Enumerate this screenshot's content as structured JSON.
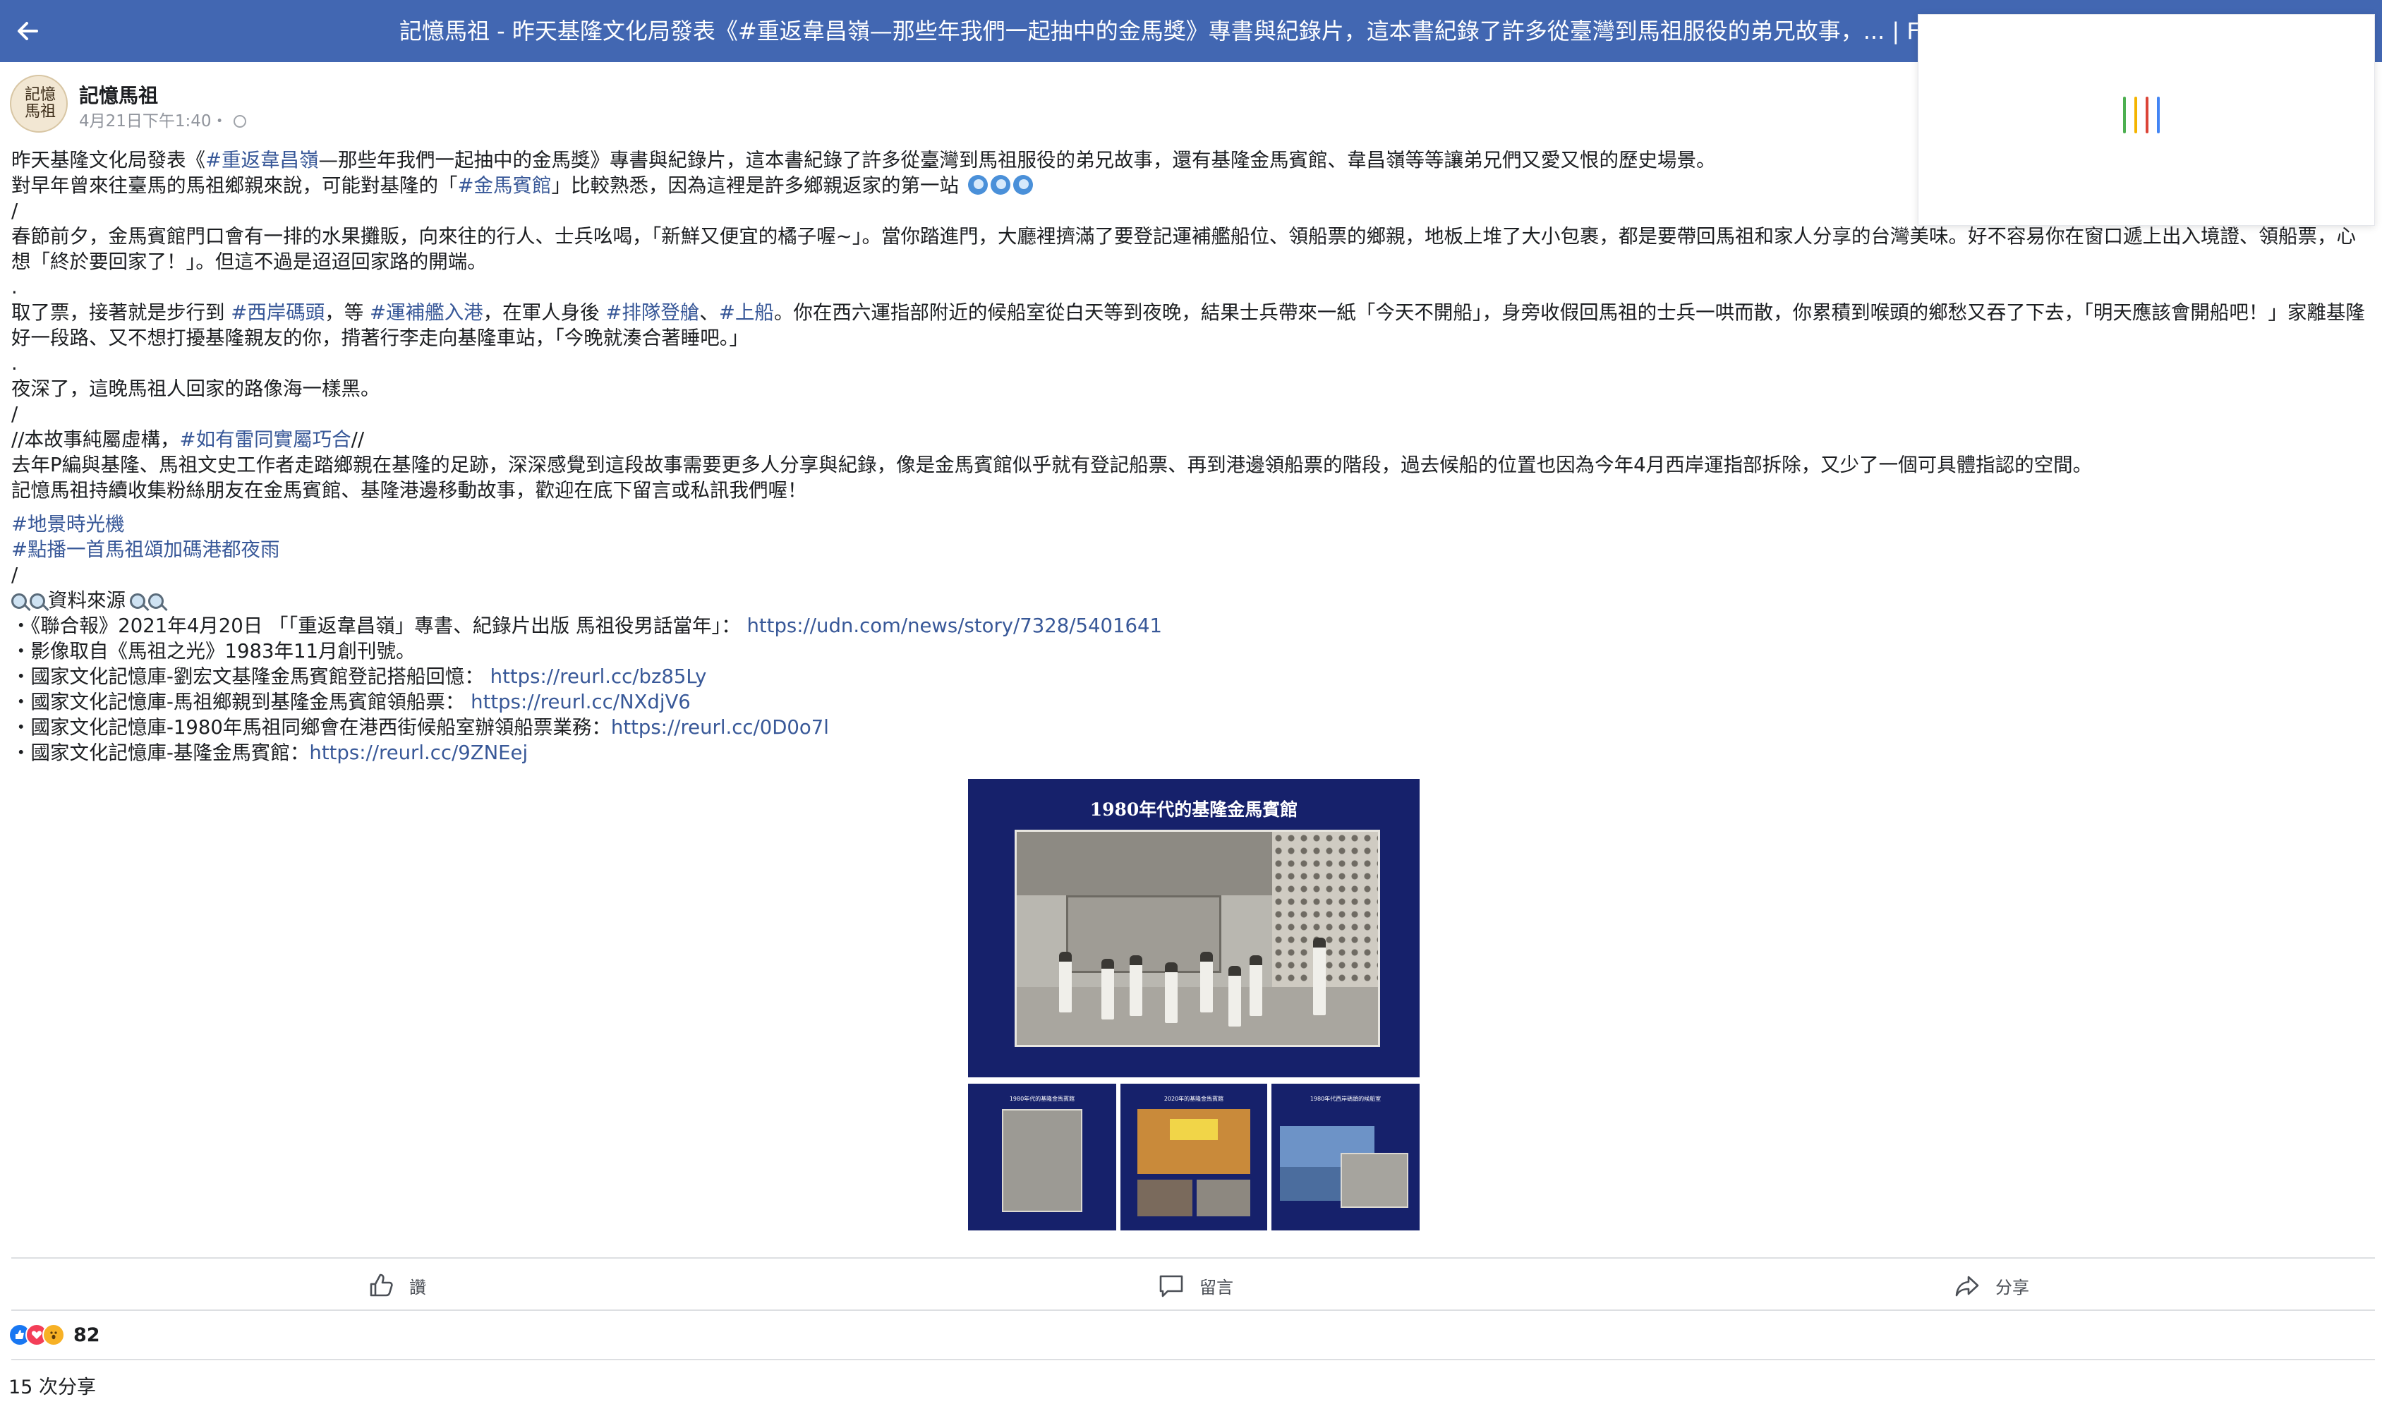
{
  "window": {
    "title": "記憶馬祖 - 昨天基隆文化局發表《#重返韋昌嶺—那些年我們一起抽中的金馬獎》專書與紀錄片，這本書紀錄了許多從臺灣到馬祖服役的弟兄故事，... | Facebook"
  },
  "colors": {
    "topbar": "#4267b2",
    "link": "#385898",
    "text": "#1c1e21",
    "meta": "#90949c",
    "image_bg": "#16216b"
  },
  "post": {
    "page_name": "記憶馬祖",
    "avatar_text": "記憶馬祖",
    "timestamp": "4月21日下午1:40",
    "privacy_icon": "globe-icon",
    "body": {
      "l1": {
        "a": "昨天基隆文化局發表《",
        "b": "#重返韋昌嶺",
        "c": "—那些年我們一起抽中的金馬獎》專書與紀錄片，這本書紀錄了許多從臺灣到馬祖服役的弟兄故事，還有基隆金馬賓館、韋昌嶺等等讓弟兄們又愛又恨的歷史場景。"
      },
      "l2": {
        "a": "對早年曾來往臺馬的馬祖鄉親來說，可能對基隆的「",
        "b": "#金馬賓館",
        "c": "」比較熟悉，因為這裡是許多鄉親返家的第一站"
      },
      "sep1": "/",
      "p2": "春節前夕，金馬賓館門口會有一排的水果攤販，向來往的行人、士兵吆喝，「新鮮又便宜的橘子喔~」。當你踏進門，大廳裡擠滿了要登記運補艦船位、領船票的鄉親，地板上堆了大小包裹，都是要帶回馬祖和家人分享的台灣美味。好不容易你在窗口遞上出入境證、領船票，心想「終於要回家了！」。但這不過是迢迢回家路的開端。",
      "sep2": ".",
      "p3": {
        "a": "取了票，接著就是步行到 ",
        "b": "#西岸碼頭",
        "c": "，等 ",
        "d": "#運補艦入港",
        "e": "，在軍人身後 ",
        "f": "#排隊登艙",
        "g": "、",
        "h": "#上船",
        "i": "。你在西六運指部附近的候船室從白天等到夜晚，結果士兵帶來一紙「今天不開船」，身旁收假回馬祖的士兵一哄而散，你累積到喉頭的鄉愁又吞了下去，「明天應該會開船吧！」家離基隆好一段路、又不想打擾基隆親友的你，揹著行李走向基隆車站，「今晚就湊合著睡吧。」"
      },
      "sep3": ".",
      "p4": "夜深了，這晚馬祖人回家的路像海一樣黑。",
      "sep4": "/",
      "p5": {
        "a": "//本故事純屬虛構，",
        "b": "#如有雷同實屬巧合",
        "c": "//"
      },
      "p6": "去年P編與基隆、馬祖文史工作者走踏鄉親在基隆的足跡，深深感覺到這段故事需要更多人分享與紀錄，像是金馬賓館似乎就有登記船票、再到港邊領船票的階段，過去候船的位置也因為今年4月西岸運指部拆除，又少了一個可具體指認的空間。",
      "p7": "記憶馬祖持續收集粉絲朋友在金馬賓館、基隆港邊移動故事，歡迎在底下留言或私訊我們喔！",
      "tag1": "#地景時光機",
      "tag2": "#點播一首馬祖頌加碼港都夜雨",
      "sep5": "/",
      "sources_title": "資料來源",
      "sources": [
        {
          "text": "・《聯合報》2021年4月20日 「「重返韋昌嶺」專書、紀錄片出版 馬祖役男話當年」： ",
          "link": "https://udn.com/news/story/7328/5401641"
        },
        {
          "text": "・影像取自《馬祖之光》1983年11月創刊號。",
          "link": ""
        },
        {
          "text": "・國家文化記憶庫-劉宏文基隆金馬賓館登記搭船回憶： ",
          "link": "https://reurl.cc/bz85Ly"
        },
        {
          "text": "・國家文化記憶庫-馬祖鄉親到基隆金馬賓館領船票： ",
          "link": "https://reurl.cc/NXdjV6"
        },
        {
          "text": "・國家文化記憶庫-1980年馬祖同鄉會在港西街候船室辦領船票業務：",
          "link": "https://reurl.cc/0D0o7l"
        },
        {
          "text": "・國家文化記憶庫-基隆金馬賓館：",
          "link": "https://reurl.cc/9ZNEej"
        }
      ]
    },
    "images": {
      "main_title": "1980年代的基隆金馬賓館",
      "thumb1_title": "1980年代的基隆金馬賓館",
      "thumb2_title": "2020年的基隆金馬賓館",
      "thumb3_title": "1980年代西岸碼頭的候船室"
    }
  },
  "actions": {
    "like": "讚",
    "comment": "留言",
    "share": "分享"
  },
  "reactions": {
    "count": "82",
    "shares": "15 次分享"
  }
}
